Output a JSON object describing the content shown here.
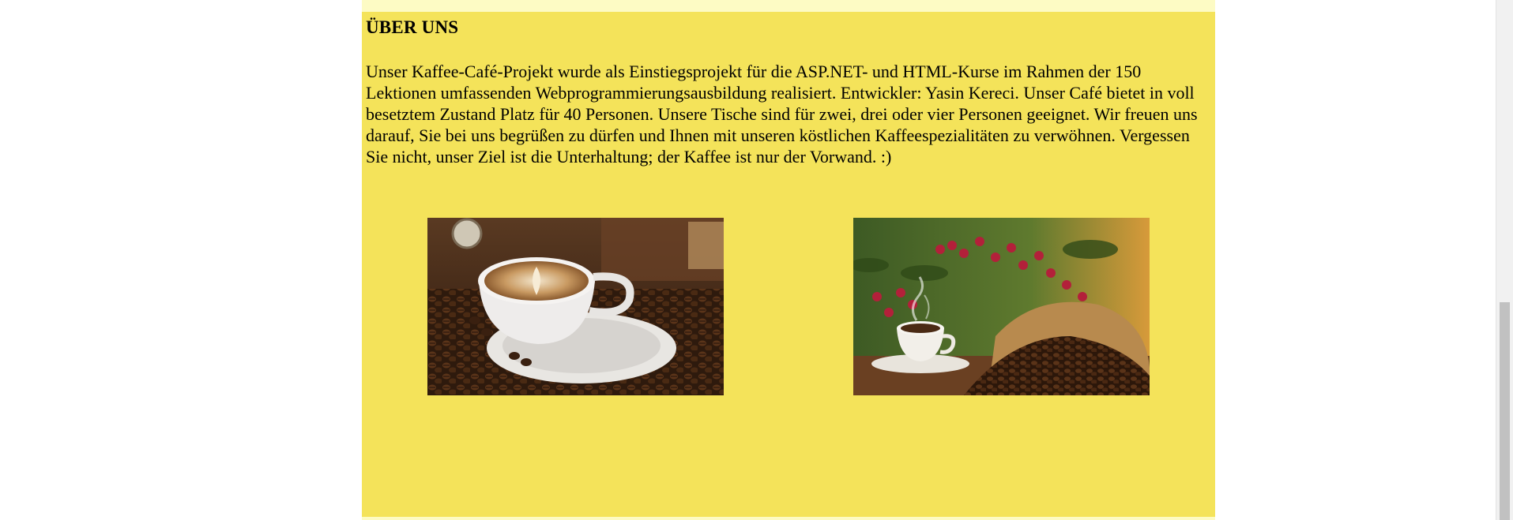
{
  "about": {
    "title": "ÜBER UNS",
    "text": "Unser Kaffee-Café-Projekt wurde als Einstiegsprojekt für die ASP.NET- und HTML-Kurse im Rahmen der 150 Lektionen umfassenden Webprogrammierungsausbildung realisiert. Entwickler: Yasin Kereci. Unser Café bietet in voll besetztem Zustand Platz für 40 Personen. Unsere Tische sind für zwei, drei oder vier Personen geeignet. Wir freuen uns darauf, Sie bei uns begrüßen zu dürfen und Ihnen mit unseren köstlichen Kaffeespezialitäten zu verwöhnen. Vergessen Sie nicht, unser Ziel ist die Unterhaltung; der Kaffee ist nur der Vorwand. :)"
  },
  "colors": {
    "section_background": "#f4e35a",
    "strip_background": "#fdfbc4",
    "page_background": "#ffffff"
  },
  "images": [
    {
      "name": "latte-art-cup-photo"
    },
    {
      "name": "coffee-cup-beans-sack-photo"
    }
  ]
}
